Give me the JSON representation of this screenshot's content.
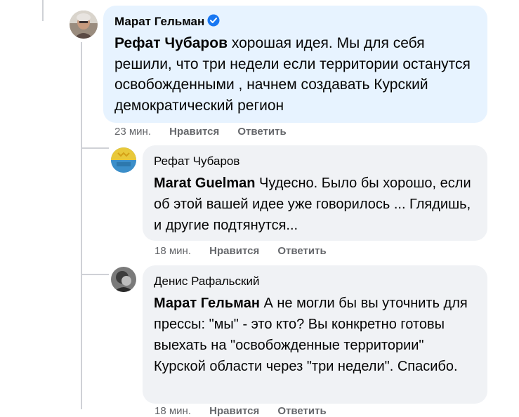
{
  "comments": [
    {
      "author": "Марат Гельман",
      "verified": true,
      "mention": "Рефат Чубаров",
      "body": " хорошая идея. Мы для себя решили, что три недели если территории останутся освобожденными , начнем создавать Курский демократический регион",
      "time": "23 мин.",
      "like_label": "Нравится",
      "reply_label": "Ответить"
    },
    {
      "author": "Рефат Чубаров",
      "verified": false,
      "mention": "Marat Guelman",
      "body": " Чудесно. Было бы хорошо, если об этой вашей идее уже говорилось ... Глядишь, и другие подтянутся...",
      "time": "18 мин.",
      "like_label": "Нравится",
      "reply_label": "Ответить"
    },
    {
      "author": "Денис Рафальский",
      "verified": false,
      "mention": "Марат Гельман",
      "body": " А не могли бы вы уточнить для прессы: \"мы\" - это кто? Вы конкретно готовы выехать на \"освобожденные территории\" Курской области через \"три недели\". Спасибо.",
      "time": "18 мин.",
      "like_label": "Нравится",
      "reply_label": "Ответить"
    }
  ],
  "colors": {
    "bubble_bg": "#f0f2f5",
    "highlight_bubble_bg": "#e7f3ff",
    "verified_blue": "#1877f2",
    "meta_gray": "#65676b"
  }
}
